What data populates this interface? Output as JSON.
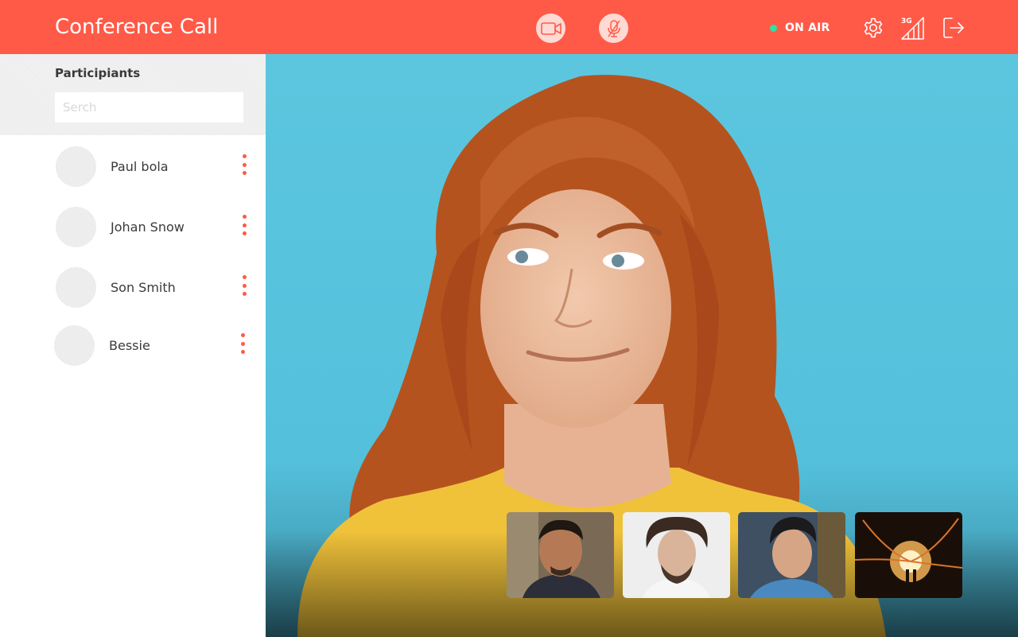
{
  "app": {
    "title": "Conference Call"
  },
  "header": {
    "controls": {
      "video_icon": "video-camera-icon",
      "mic_icon": "mic-muted-icon"
    },
    "status": {
      "label": "ON AIR",
      "color": "#2be3a7"
    },
    "signal_label": "3G",
    "icons": [
      "gear-icon",
      "signal-3g-icon",
      "logout-icon"
    ]
  },
  "sidebar": {
    "title": "Participiants",
    "search": {
      "placeholder": "Serch",
      "value": ""
    },
    "participants": [
      {
        "name": "Paul bola"
      },
      {
        "name": "Johan Snow"
      },
      {
        "name": "Son Smith"
      },
      {
        "name": "Bessie"
      }
    ]
  },
  "colors": {
    "accent": "#ff5a47",
    "header_text": "#ffffff",
    "control_bg": "#ffd9d3"
  }
}
